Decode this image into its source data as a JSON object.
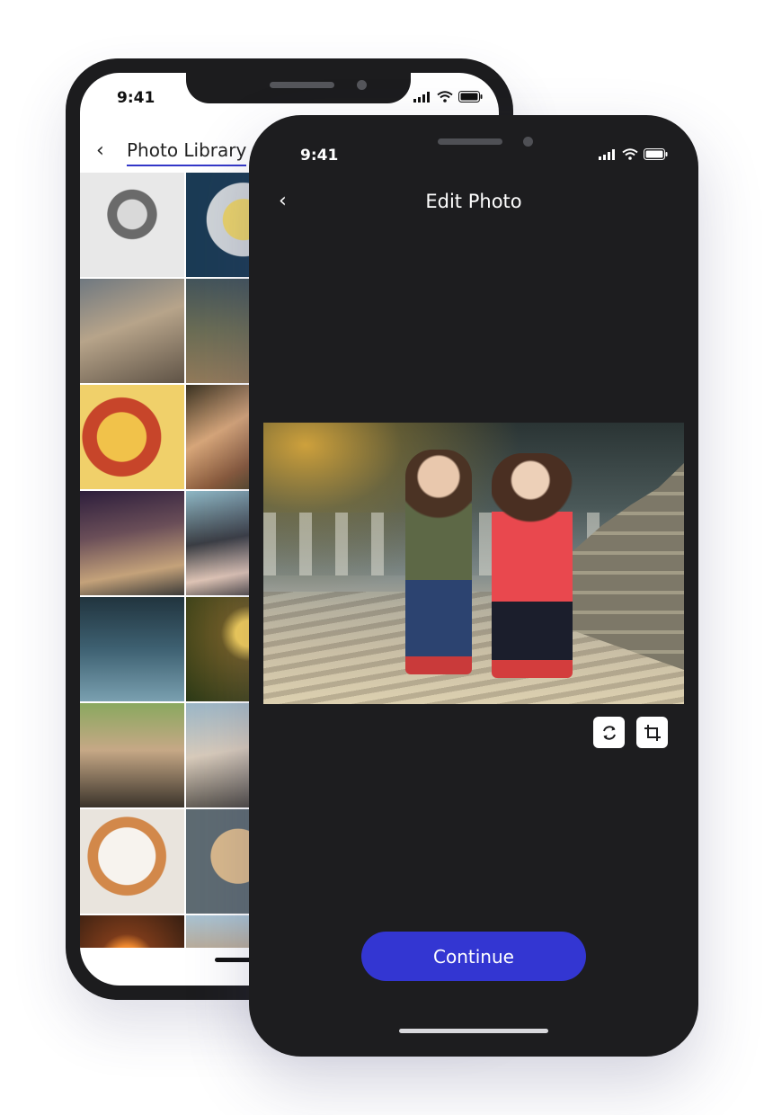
{
  "library_screen": {
    "status": {
      "time": "9:41"
    },
    "nav": {
      "back_icon": "chevron-left-icon",
      "title": "Photo Library"
    },
    "accent_color": "#3337c8",
    "photo_count_visible": 16
  },
  "edit_screen": {
    "status": {
      "time": "9:41"
    },
    "nav": {
      "back_icon": "chevron-left-icon",
      "title": "Edit Photo"
    },
    "tools": [
      {
        "icon": "rotate-icon"
      },
      {
        "icon": "crop-icon"
      }
    ],
    "continue_label": "Continue",
    "button_color": "#3336d2",
    "background_color": "#1d1d1f"
  }
}
